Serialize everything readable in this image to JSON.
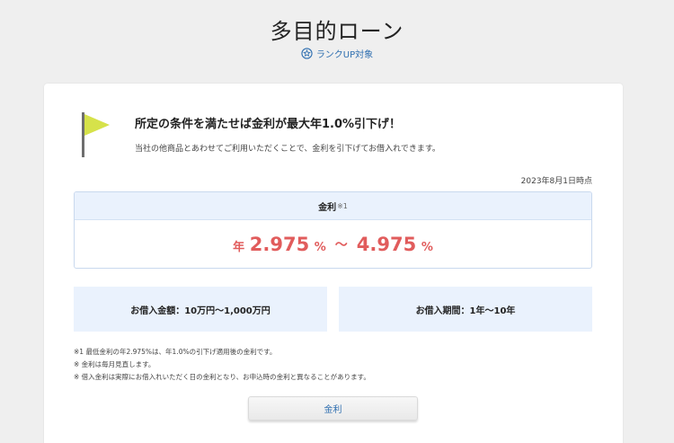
{
  "header": {
    "title": "多目的ローン",
    "rank_up_label": "ランクUP対象"
  },
  "promo": {
    "title": "所定の条件を満たせば金利が最大年1.0%引下げ！",
    "description": "当社の他商品とあわせてご利用いただくことで、金利を引下げてお借入れできます。",
    "as_of": "2023年8月1日時点"
  },
  "rate": {
    "label": "金利",
    "note_mark": "※1",
    "prefix": "年",
    "min_value": "2.975",
    "min_unit": "%",
    "separator": "〜",
    "max_value": "4.975",
    "max_unit": "%"
  },
  "info": {
    "amount": "お借入金額：10万円〜1,000万円",
    "period": "お借入期間：1年〜10年"
  },
  "notes": [
    "※1 最低金利の年2.975%は、年1.0%の引下げ適用後の金利です。",
    "※ 金利は毎月見直します。",
    "※ 借入金利は実際にお借入れいただく日の金利となり、お申込時の金利と異なることがあります。"
  ],
  "buttons": {
    "rate": "金利"
  },
  "colors": {
    "accent": "#2f6fb0",
    "rate": "#e15c5c",
    "flag": "#d6e24a",
    "panel": "#eaf2fd"
  }
}
